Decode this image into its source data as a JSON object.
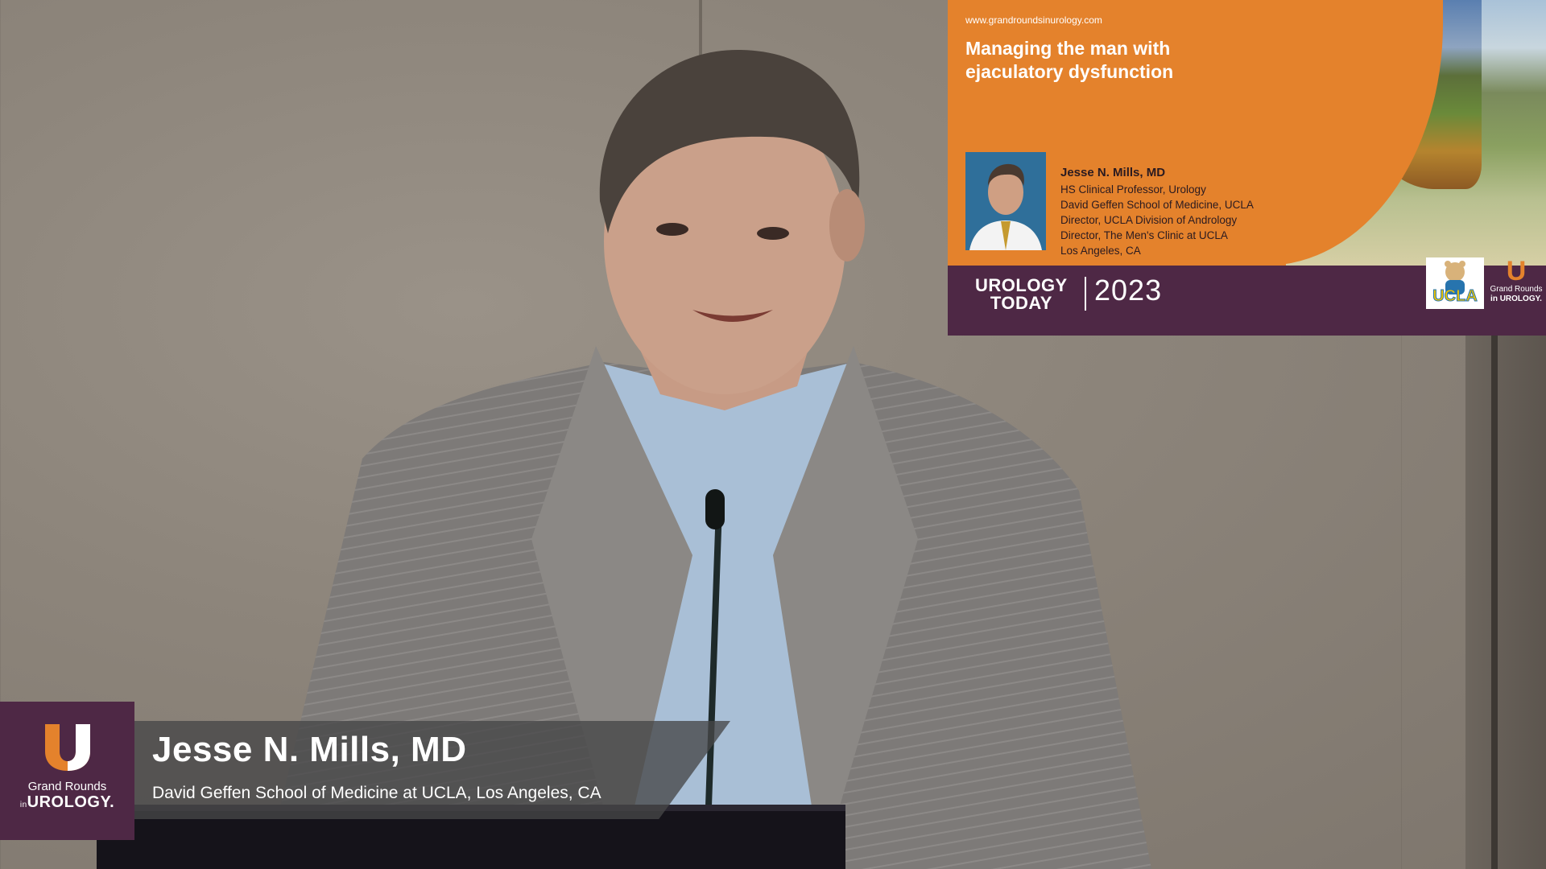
{
  "card": {
    "url": "www.grandroundsinurology.com",
    "title_line1": "Managing the man with",
    "title_line2": "ejaculatory dysfunction",
    "speaker_name": "Jesse N. Mills, MD",
    "speaker_lines": [
      "HS Clinical Professor, Urology",
      "David Geffen School of Medicine, UCLA",
      "Director, UCLA Division of Andrology",
      "Director, The Men's Clinic at UCLA",
      "Los Angeles, CA"
    ],
    "brand_line1": "UROLOGY",
    "brand_line2": "TODAY",
    "year": "2023",
    "ucla_label": "UCLA",
    "gr_small_line1": "Grand Rounds",
    "gr_small_line2": "in UROLOGY."
  },
  "lower_third": {
    "logo_line1": "Grand Rounds",
    "logo_in": "in",
    "logo_line2": "UROLOGY.",
    "name": "Jesse N. Mills, MD",
    "affiliation": "David Geffen School of Medicine at UCLA, Los Angeles, CA"
  },
  "colors": {
    "brand_purple": "#4e2845",
    "brand_orange": "#e4822c"
  },
  "icons": {
    "grand_rounds_logo": "u-logo-icon",
    "ucla_mascot": "ucla-bruin-logo"
  }
}
